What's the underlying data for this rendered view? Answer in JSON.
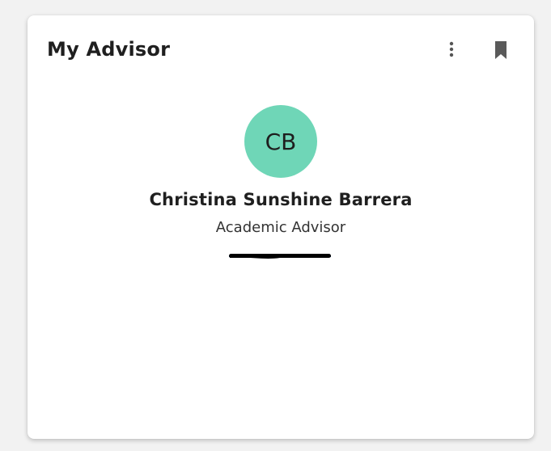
{
  "card": {
    "title": "My Advisor",
    "menu_icon": "more-vertical-icon",
    "bookmark_icon": "bookmark-icon"
  },
  "advisor": {
    "initials": "CB",
    "avatar_color": "#6fd6b7",
    "name": "Christina Sunshine Barrera",
    "role": "Academic Advisor",
    "contact_redacted": true,
    "link_color": "#1a4fa3"
  }
}
